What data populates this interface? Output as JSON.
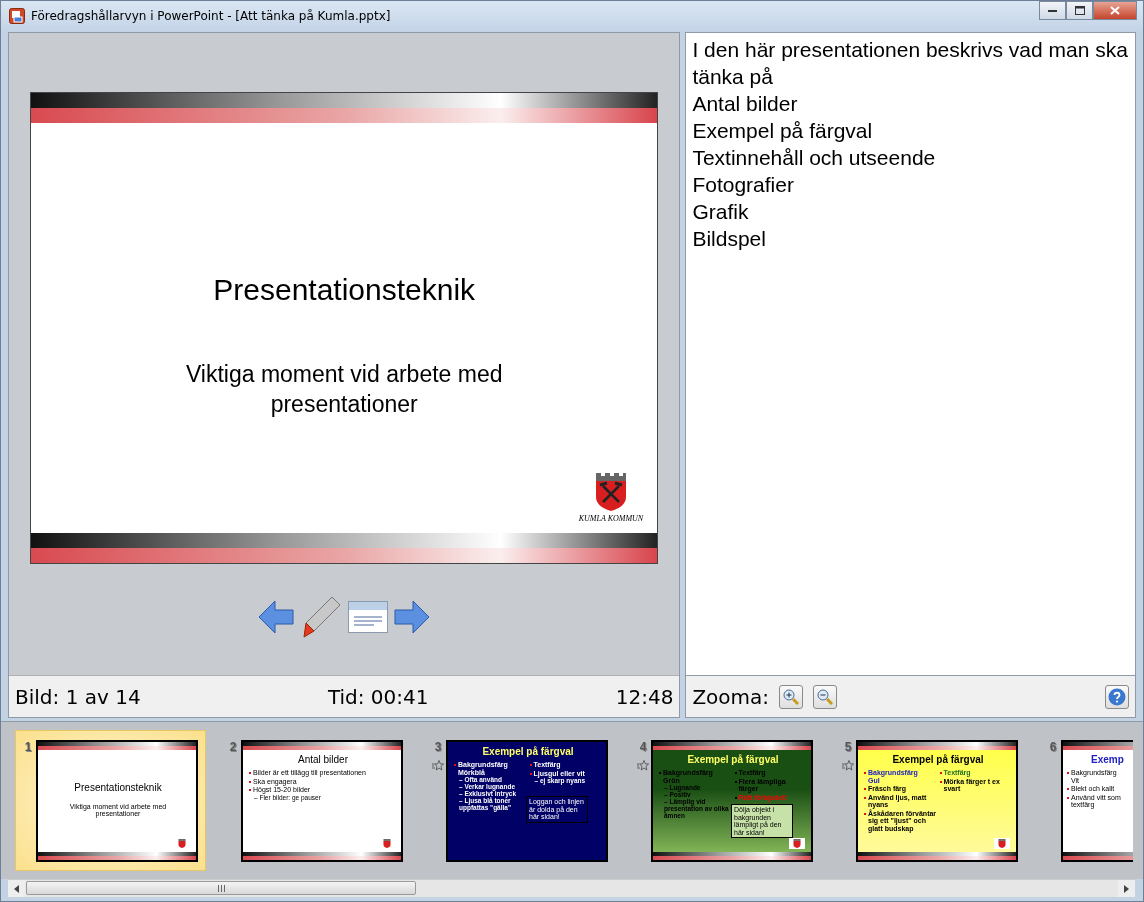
{
  "window": {
    "title": "Föredragshållarvyn i PowerPoint - [Att tänka på Kumla.pptx]"
  },
  "slide": {
    "title": "Presentationsteknik",
    "subtitle": "Viktiga moment vid arbete med presentationer",
    "logo_text": "KUMLA KOMMUN"
  },
  "notes": [
    "I den här presentationen beskrivs vad man ska tänka på",
    "Antal bilder",
    "Exempel på färgval",
    "Textinnehåll och utseende",
    "Fotografier",
    "Grafik",
    "Bildspel"
  ],
  "status": {
    "slide_counter": "Bild: 1 av 14",
    "timer": "Tid: 00:41",
    "clock": "12:48"
  },
  "zoom": {
    "label": "Zooma:"
  },
  "thumbnails": [
    {
      "number": "1",
      "selected": true,
      "animated": false,
      "kind": "white",
      "clipped": false,
      "title": "Presentationsteknik",
      "subtitle": "Viktiga moment vid arbete med presentationer",
      "logo": true
    },
    {
      "number": "2",
      "selected": false,
      "animated": false,
      "kind": "white",
      "clipped": false,
      "title": "Antal bilder",
      "columns": [
        [
          {
            "text": "Bilder är ett tillägg till presentationen"
          },
          {
            "text": "Ska engagera"
          },
          {
            "text": "Högst 15-20 bilder",
            "children": [
              {
                "text": "– Fler bilder: ge pauser"
              }
            ]
          }
        ]
      ],
      "logo": true
    },
    {
      "number": "3",
      "selected": false,
      "animated": true,
      "kind": "navy",
      "clipped": false,
      "title": "Exempel på färgval",
      "columns": [
        [
          {
            "text": "Bakgrundsfärg",
            "line2": "Mörkblå",
            "children": [
              {
                "text": "– Ofta använd"
              },
              {
                "text": "– Verkar lugnande"
              },
              {
                "text": "– Exklusivt intryck"
              },
              {
                "text": "– Ljusa blå toner uppfattas \"gälla\""
              }
            ]
          }
        ],
        [
          {
            "text": "Textfärg"
          },
          {
            "text": "Ljusgul eller vit",
            "children": [
              {
                "text": "– ej skarp nyans"
              }
            ]
          }
        ]
      ],
      "note": "Loggan och linjen är dolda på den här sidan!",
      "logo": false
    },
    {
      "number": "4",
      "selected": false,
      "animated": true,
      "kind": "green",
      "clipped": false,
      "title": "Exempel på färgval",
      "columns": [
        [
          {
            "text": "Bakgrundsfärg",
            "line2": "Grön",
            "children": [
              {
                "text": "– Lugnande"
              },
              {
                "text": "– Positiv"
              },
              {
                "text": "– Lämplig vid presentation av olika ämnen"
              }
            ]
          }
        ],
        [
          {
            "text": "Textfärg"
          },
          {
            "text": "Flera lämpliga färger"
          },
          {
            "text": "Rött förbjudet!",
            "color": "#ff0000"
          }
        ]
      ],
      "note": "Dölja objekt i bakgrunden lämpligt på den här sidan!",
      "logo": true
    },
    {
      "number": "5",
      "selected": false,
      "animated": true,
      "kind": "yellow",
      "clipped": false,
      "title": "Exempel på färgval",
      "columns": [
        [
          {
            "text": "Bakgrundsfärg",
            "line2": "Gul",
            "color": "#2020c0"
          },
          {
            "text": "Fräsch färg"
          },
          {
            "text": "Använd ljus, matt nyans"
          },
          {
            "text": "Åskådaren förväntar sig ett \"ljust\" och glatt budskap"
          }
        ],
        [
          {
            "text": "Textfärg",
            "color": "#207020"
          },
          {
            "text": "Mörka färger t ex svart"
          }
        ]
      ],
      "logo": true
    },
    {
      "number": "6",
      "selected": false,
      "animated": false,
      "kind": "accent",
      "clipped": true,
      "title": "Exemp",
      "columns": [
        [
          {
            "text": "Bakgrundsfärg",
            "line2": "Vit"
          },
          {
            "text": "Blekt och kallt"
          },
          {
            "text": "Använd vitt som textfärg"
          }
        ]
      ],
      "logo": false
    }
  ]
}
